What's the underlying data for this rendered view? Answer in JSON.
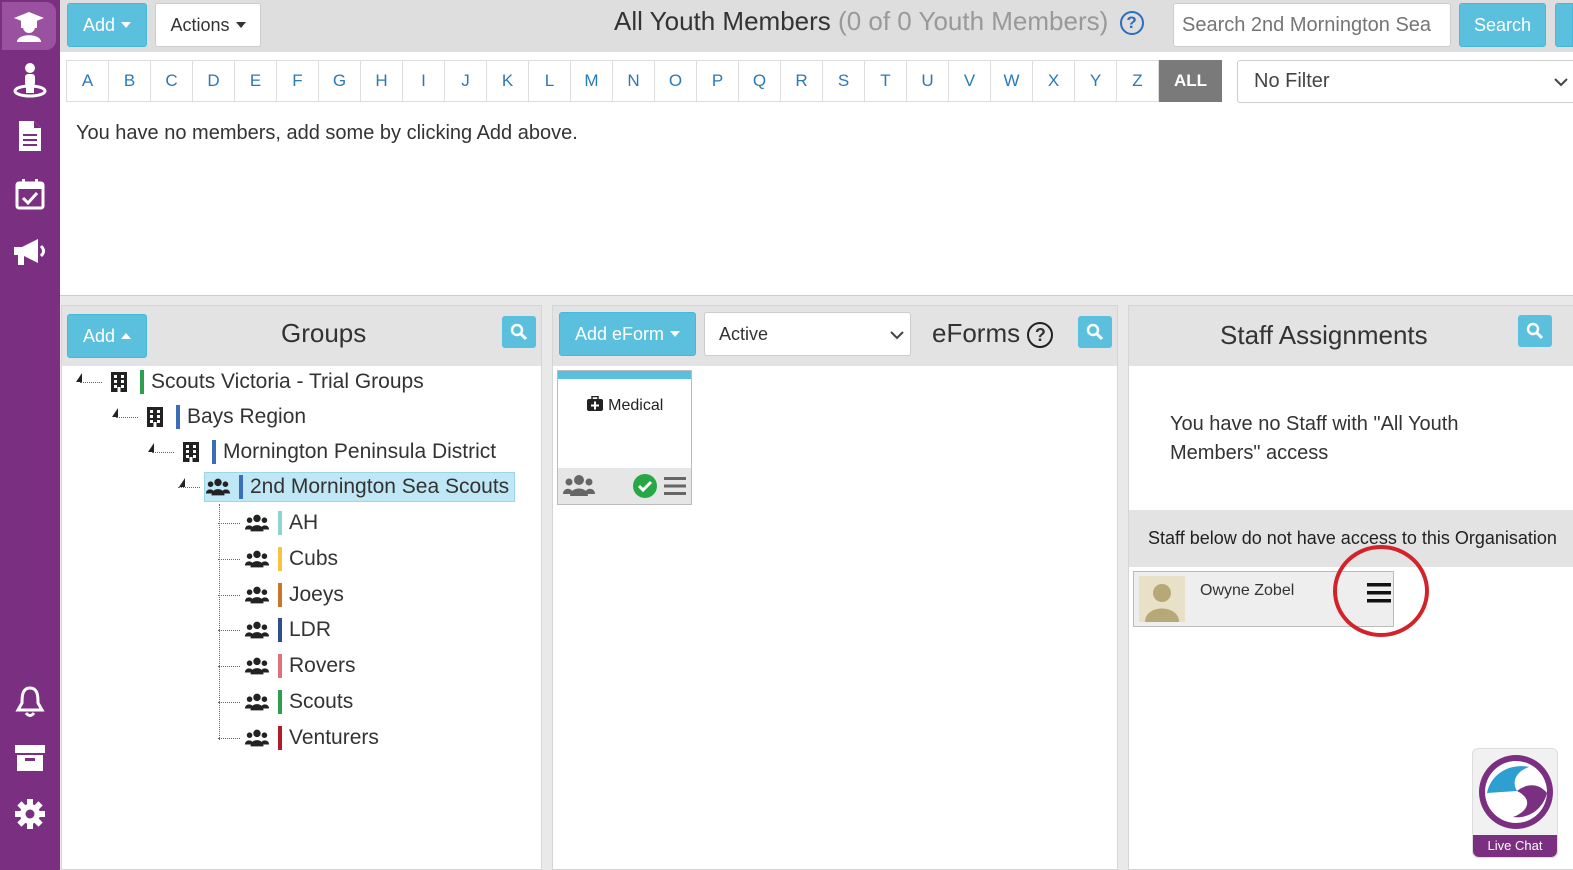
{
  "sidebar": {
    "items": [
      {
        "icon": "graduation-user-icon"
      },
      {
        "icon": "person-icon"
      },
      {
        "icon": "document-icon"
      },
      {
        "icon": "calendar-check-icon"
      },
      {
        "icon": "megaphone-icon"
      },
      {
        "icon": "bell-icon"
      },
      {
        "icon": "archive-icon"
      },
      {
        "icon": "gear-icon"
      }
    ],
    "bg_color": "#7b2f81"
  },
  "toolbar": {
    "add_label": "Add",
    "actions_label": "Actions",
    "title": "All Youth Members",
    "subtitle": "(0 of 0 Youth Members)",
    "search_placeholder": "Search 2nd Mornington Sea",
    "search_button": "Search"
  },
  "alphabet": [
    "A",
    "B",
    "C",
    "D",
    "E",
    "F",
    "G",
    "H",
    "I",
    "J",
    "K",
    "L",
    "M",
    "N",
    "O",
    "P",
    "Q",
    "R",
    "S",
    "T",
    "U",
    "V",
    "W",
    "X",
    "Y",
    "Z"
  ],
  "alphabet_all": "ALL",
  "filter": {
    "selected": "No Filter"
  },
  "members_empty_message": "You have no members, add some by clicking Add above.",
  "groups_panel": {
    "add_label": "Add",
    "title": "Groups",
    "tree": [
      {
        "label": "Scouts Victoria - Trial Groups",
        "icon": "building-icon",
        "color": "#2e9e4f"
      },
      {
        "label": "Bays Region",
        "icon": "building-icon",
        "color": "#3a6fb7"
      },
      {
        "label": "Mornington Peninsula District",
        "icon": "building-icon",
        "color": "#3a6fb7"
      },
      {
        "label": "2nd Mornington Sea Scouts",
        "icon": "users-icon",
        "color": "#3a6fb7",
        "selected": true
      },
      {
        "label": "AH",
        "icon": "users-icon",
        "color": "#8fd3d0"
      },
      {
        "label": "Cubs",
        "icon": "users-icon",
        "color": "#f5c542"
      },
      {
        "label": "Joeys",
        "icon": "users-icon",
        "color": "#c9752a"
      },
      {
        "label": "LDR",
        "icon": "users-icon",
        "color": "#2d4f8a"
      },
      {
        "label": "Rovers",
        "icon": "users-icon",
        "color": "#e0707a"
      },
      {
        "label": "Scouts",
        "icon": "users-icon",
        "color": "#2e9e4f"
      },
      {
        "label": "Venturers",
        "icon": "users-icon",
        "color": "#b01c2e"
      }
    ]
  },
  "eforms_panel": {
    "add_label": "Add eForm",
    "status_selected": "Active",
    "title": "eForms",
    "cards": [
      {
        "label": "Medical",
        "icon": "medical-kit-icon"
      }
    ]
  },
  "staff_panel": {
    "title": "Staff Assignments",
    "no_staff_message": "You have no Staff with \"All Youth Members\" access",
    "no_access_band": "Staff below do not have access to this Organisation",
    "staff": [
      {
        "name": "Owyne Zobel"
      }
    ]
  },
  "live_chat": {
    "label": "Live Chat"
  },
  "colors": {
    "accent": "#5bc0de",
    "purple": "#7b2f81",
    "highlight": "#d2232a"
  }
}
